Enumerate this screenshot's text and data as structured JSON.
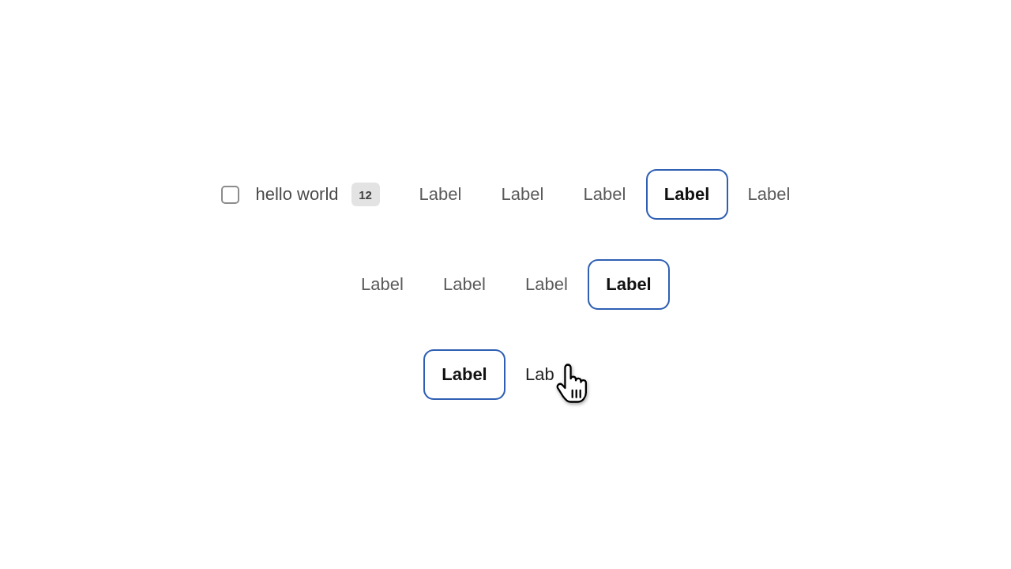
{
  "rows": [
    {
      "lead": {
        "checked": false,
        "label": "hello world",
        "count": "12"
      },
      "items": [
        {
          "label": "Label",
          "selected": false,
          "hovered": false
        },
        {
          "label": "Label",
          "selected": false,
          "hovered": false
        },
        {
          "label": "Label",
          "selected": false,
          "hovered": false
        },
        {
          "label": "Label",
          "selected": true,
          "hovered": false
        },
        {
          "label": "Label",
          "selected": false,
          "hovered": false
        }
      ]
    },
    {
      "items": [
        {
          "label": "Label",
          "selected": false,
          "hovered": false
        },
        {
          "label": "Label",
          "selected": false,
          "hovered": false
        },
        {
          "label": "Label",
          "selected": false,
          "hovered": false
        },
        {
          "label": "Label",
          "selected": true,
          "hovered": false
        }
      ]
    },
    {
      "items": [
        {
          "label": "Label",
          "selected": true,
          "hovered": false
        },
        {
          "label": "Lab",
          "selected": false,
          "hovered": true
        }
      ]
    }
  ]
}
